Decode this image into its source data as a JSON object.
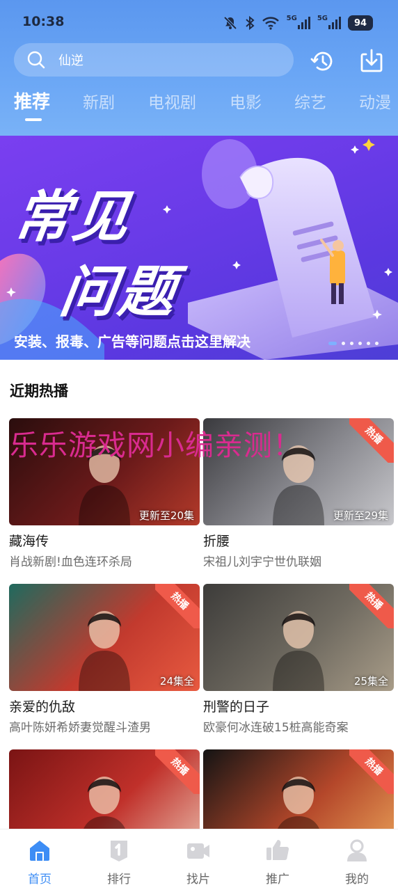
{
  "status_bar": {
    "time": "10:38",
    "signal1_label": "5G",
    "signal2_label": "5G",
    "battery": "94",
    "icons": [
      "mute-icon",
      "bluetooth-icon",
      "wifi-icon",
      "signal-icon",
      "signal-icon",
      "battery-icon"
    ]
  },
  "search": {
    "value": "仙逆"
  },
  "tabs": [
    {
      "label": "推荐",
      "active": true
    },
    {
      "label": "新剧"
    },
    {
      "label": "电视剧"
    },
    {
      "label": "电影"
    },
    {
      "label": "综艺"
    },
    {
      "label": "动漫"
    }
  ],
  "banner": {
    "title_line1": "常见",
    "title_line2": "问题",
    "caption": "安装、报毒、广告等问题点击这里解决",
    "page_count": 6,
    "active_page": 1
  },
  "section": {
    "title": "近期热播"
  },
  "watermark": "乐乐游戏网小编亲测！",
  "cards": [
    {
      "title": "藏海传",
      "subtitle": "肖战新剧!血色连环杀局",
      "episodes": "更新至20集",
      "hot": false,
      "colors": [
        "#2a0d0d",
        "#6b1a1a",
        "#b33a2a"
      ]
    },
    {
      "title": "折腰",
      "subtitle": "宋祖儿刘宇宁世仇联姻",
      "episodes": "更新至29集",
      "hot": true,
      "hot_label": "热播",
      "colors": [
        "#3a3a3e",
        "#8a8a90",
        "#c8c8cc"
      ]
    },
    {
      "title": "亲爱的仇敌",
      "subtitle": "高叶陈妍希娇妻觉醒斗渣男",
      "episodes": "24集全",
      "hot": true,
      "hot_label": "热播",
      "colors": [
        "#1f6a5e",
        "#c23a2e",
        "#e85a40"
      ]
    },
    {
      "title": "刑警的日子",
      "subtitle": "欧豪何冰连破15桩高能奇案",
      "episodes": "25集全",
      "hot": true,
      "hot_label": "热播",
      "colors": [
        "#3d3c3a",
        "#6f6a60",
        "#a89c88"
      ]
    },
    {
      "title": "",
      "subtitle": "",
      "episodes": "",
      "hot": true,
      "hot_label": "热播",
      "colors": [
        "#7a1414",
        "#c0302a",
        "#e8b9a8"
      ]
    },
    {
      "title": "",
      "subtitle": "",
      "episodes": "",
      "hot": true,
      "hot_label": "热播",
      "colors": [
        "#141414",
        "#b4472a",
        "#e8a058"
      ]
    }
  ],
  "bottom_nav": [
    {
      "label": "首页",
      "icon": "home-icon",
      "active": true
    },
    {
      "label": "排行",
      "icon": "ranking-icon"
    },
    {
      "label": "找片",
      "icon": "video-camera-icon"
    },
    {
      "label": "推广",
      "icon": "thumbs-up-icon"
    },
    {
      "label": "我的",
      "icon": "profile-icon"
    }
  ],
  "colors": {
    "header_top": "#5b97ef",
    "accent": "#3d8df5",
    "hot_badge": "#ef5a4a",
    "watermark": "#d92b8f"
  }
}
